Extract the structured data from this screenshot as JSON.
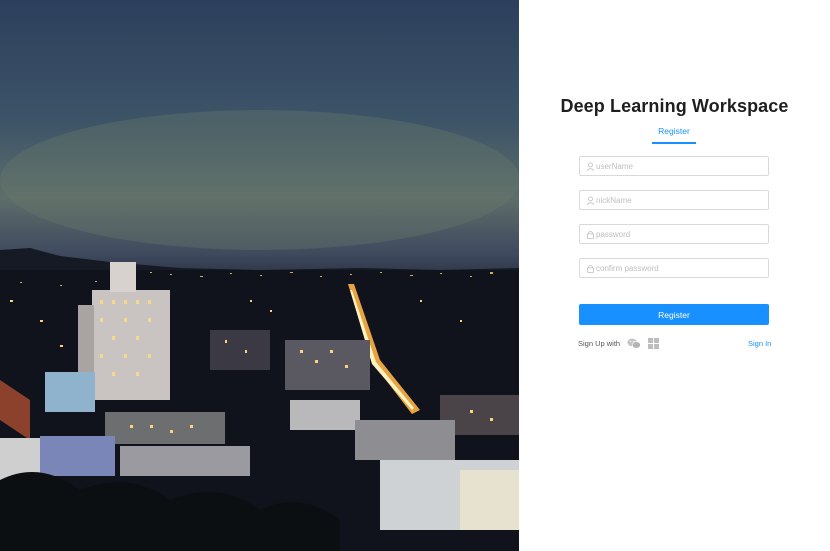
{
  "app": {
    "title": "Deep Learning Workspace"
  },
  "tabs": [
    {
      "label": "Register",
      "active": true
    }
  ],
  "form": {
    "username_placeholder": "userName",
    "nickname_placeholder": "nickName",
    "password_placeholder": "password",
    "confirm_password_placeholder": "confirm password",
    "submit_label": "Register"
  },
  "footer": {
    "signup_label": "Sign Up with",
    "signup_icons": [
      "wechat-icon",
      "windows-icon"
    ],
    "signin_label": "Sign In"
  },
  "colors": {
    "accent": "#1890ff",
    "border": "#d9d9d9",
    "placeholder": "#bfbfbf"
  },
  "background_image": {
    "description_icon": "city-night-photo"
  }
}
